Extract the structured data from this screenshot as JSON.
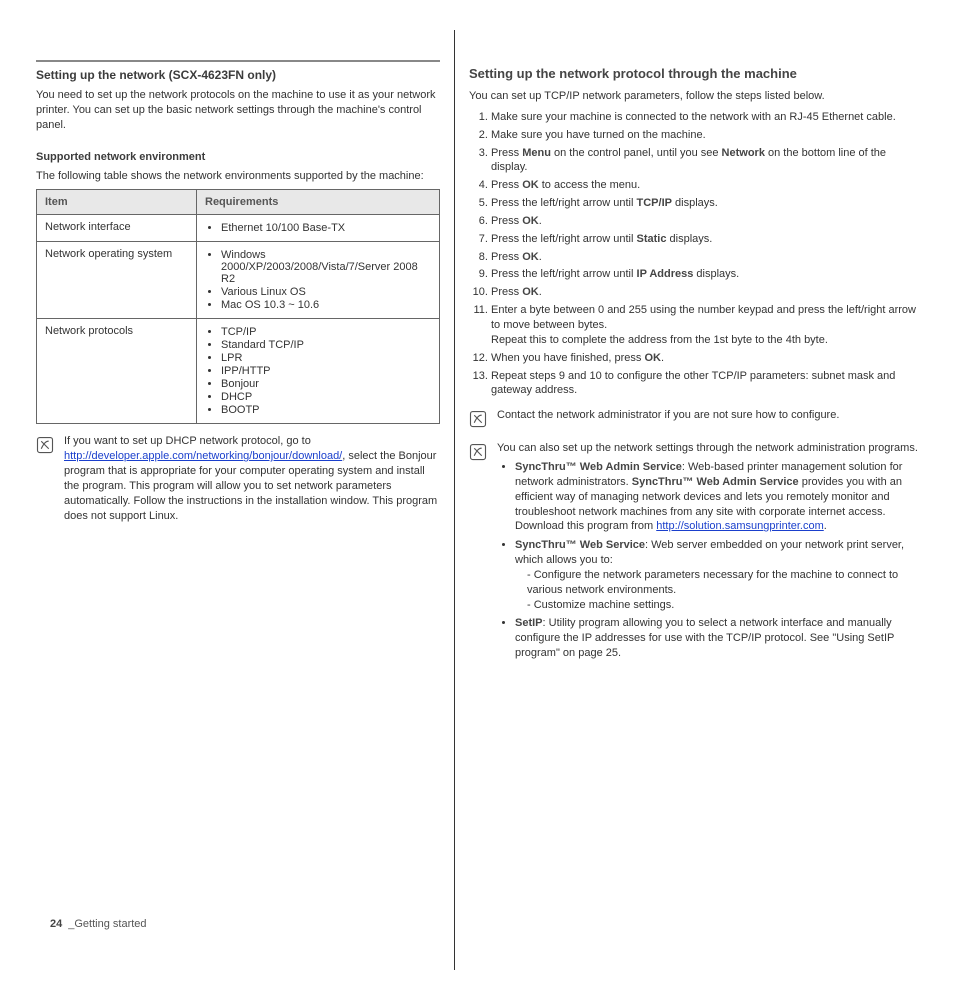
{
  "left": {
    "heading1": "Setting up the network (SCX-4623FN only)",
    "intro": "You need to set up the network protocols on the machine to use it as your network printer. You can set up the basic network settings through the machine's control panel.",
    "subhead1": "Supported network environment",
    "tableIntro": "The following table shows the network environments supported by the machine:",
    "tableHead": {
      "c1": "Item",
      "c2": "Requirements"
    },
    "rows": {
      "r1_label": "Network interface",
      "r1_items": [
        "Ethernet 10/100 Base-TX"
      ],
      "r2_label": "Network operating system",
      "r2_items": [
        "Windows 2000/XP/2003/2008/Vista/7/Server 2008 R2",
        "Various Linux OS",
        "Mac OS 10.3 ~ 10.6"
      ],
      "r3_label": "Network protocols",
      "r3_items": [
        "TCP/IP",
        "Standard TCP/IP",
        "LPR",
        "IPP/HTTP",
        "Bonjour",
        "DHCP",
        "BOOTP"
      ]
    },
    "noteDHCP": {
      "pre": "If you want to set up DHCP network protocol, go to ",
      "link1_text": "http://developer.apple.com/networking/bonjour/download/",
      "post": ", select the Bonjour program that is appropriate for your computer operating system and install the program. This program will allow you to set network parameters automatically. Follow the instructions in the installation window. This program does not support Linux."
    }
  },
  "right": {
    "sectionHead": "Setting up the network protocol through the machine",
    "lead": "You can set up TCP/IP network parameters, follow the steps listed below.",
    "steps": {
      "s1": "Make sure your machine is connected to the network with an RJ-45 Ethernet cable.",
      "s2": "Make sure you have turned on the machine.",
      "s3_a": "Press ",
      "s3_b": "Menu",
      "s3_c": " on the control panel, until you see ",
      "s3_d": "Network",
      "s3_e": " on the bottom line of the display.",
      "s4_a": "Press ",
      "s4_b": "OK",
      "s4_c": " to access the menu.",
      "s5_a": "Press the left/right arrow until ",
      "s5_b": "TCP/IP",
      "s5_c": " displays.",
      "s6_a": "Press ",
      "s6_b": "OK",
      "s6_c": ".",
      "s7_a": "Press the left/right arrow until ",
      "s7_b": "Static",
      "s7_c": " displays.",
      "s8_a": "Press ",
      "s8_b": "OK",
      "s8_c": ".",
      "s9_a": "Press the left/right arrow until ",
      "s9_b": "IP Address",
      "s9_c": " displays.",
      "s10_a": "Press ",
      "s10_b": "OK",
      "s10_c": ".",
      "s11": "Enter a byte between 0 and 255 using the number keypad and press the left/right arrow  to move between bytes.",
      "s11b": "Repeat this to complete the address from the 1st byte to the 4th byte.",
      "s12_a": "When you have finished, press ",
      "s12_b": "OK",
      "s12_c": ".",
      "s13": "Repeat steps 9 and 10 to configure the other TCP/IP parameters: subnet mask and gateway address."
    },
    "note1": "Contact the network administrator if you are not sure how to configure.",
    "note2_lead": "You can also set up the network settings through the network administration programs.",
    "note2_items": {
      "i1_bold": "SyncThru™ Web Admin Service",
      "i1_after": ": Web-based printer management solution for network administrators. ",
      "i1_bold2": "SyncThru™ Web Admin Service",
      "i1_rest": " provides you with an efficient way of managing network devices and lets you remotely monitor and troubleshoot network machines from any site with corporate internet access. Download this program from ",
      "i1_link": "http://solution.samsungprinter.com",
      "i1_dot": ".",
      "i2_bold": "SyncThru™ Web Service",
      "i2_after": ": Web server embedded on your network print server, which allows you to:",
      "i2_d1": "- Configure the network parameters necessary for the machine to connect to various network environments.",
      "i2_d2": "- Customize machine settings.",
      "i3_bold": "SetIP",
      "i3_after": ": Utility program allowing you to select a network interface and manually configure the IP addresses for use with the TCP/IP protocol. See \"Using SetIP program\" on page 25."
    }
  },
  "footer": {
    "page": "24",
    "label": "_Getting started"
  }
}
